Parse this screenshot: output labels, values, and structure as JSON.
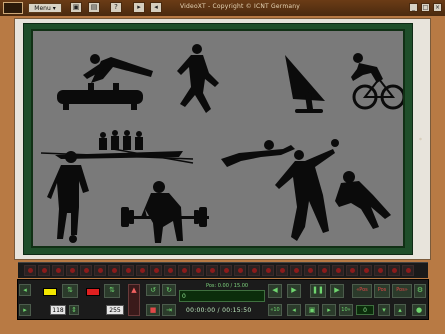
{
  "window": {
    "title": "VideoXT  -  Copyright © ICNT Germany",
    "menu_label": "Menu",
    "buttons": [
      "save-icon",
      "disk-icon",
      "help-icon",
      "play-small-icon",
      "record-icon"
    ],
    "win_controls": [
      "minimize",
      "maximize",
      "close"
    ]
  },
  "scene": {
    "figures": [
      "gymnast-pommel-horse",
      "sprinter",
      "windsurfer",
      "cyclist",
      "rowing-crew",
      "swimmer",
      "handball-player",
      "footballer",
      "weightlifter",
      "running-back"
    ]
  },
  "controls": {
    "line_width": "118",
    "opacity": "255",
    "pos_label": "Pos: 0.00 / 15.00",
    "pos_value": "0",
    "time": "00:00:00 / 00:15:50",
    "speed_value": "0",
    "rew_label": "«Pos",
    "pos_btn_label": "Pos",
    "fwd_label": "Pos»",
    "jump_back_label": "«10",
    "jump_fwd_label": "10»"
  },
  "colors": {
    "screen_bg": "#7a7a7a",
    "board_green": "#1f4e2a",
    "brand_brown": "#b87a44",
    "silhouette": "#0b0b0b",
    "swatch_yellow": "#f2e600",
    "swatch_red": "#e02020",
    "accent_green": "#6fd56f"
  }
}
